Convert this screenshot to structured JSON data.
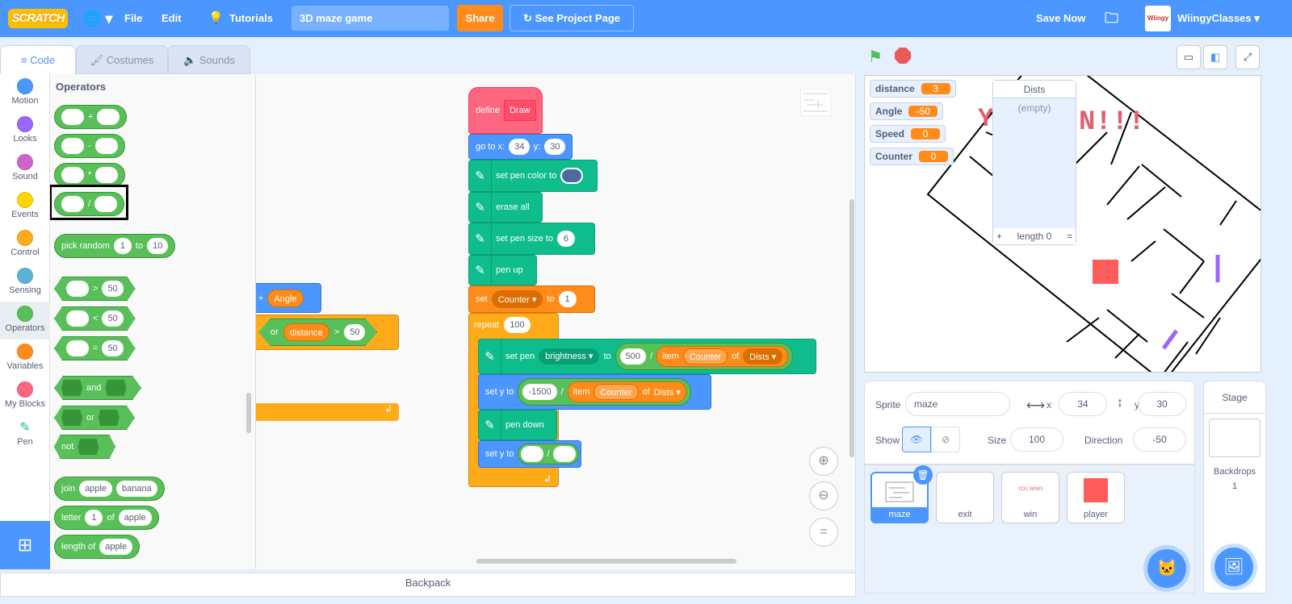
{
  "menubar": {
    "logo": "SCRATCH",
    "file": "File",
    "edit": "Edit",
    "tutorials": "Tutorials",
    "project_title": "3D maze game",
    "share": "Share",
    "see_project": "See Project Page",
    "save_now": "Save Now",
    "username": "WiingyClasses",
    "avatar_text": "Wiingy"
  },
  "tabs": [
    {
      "label": "Code"
    },
    {
      "label": "Costumes"
    },
    {
      "label": "Sounds"
    }
  ],
  "categories": [
    {
      "label": "Motion",
      "color": "#4c97ff"
    },
    {
      "label": "Looks",
      "color": "#9966ff"
    },
    {
      "label": "Sound",
      "color": "#cf63cf"
    },
    {
      "label": "Events",
      "color": "#ffd500"
    },
    {
      "label": "Control",
      "color": "#ffab19"
    },
    {
      "label": "Sensing",
      "color": "#5cb1d6"
    },
    {
      "label": "Operators",
      "color": "#59c059"
    },
    {
      "label": "Variables",
      "color": "#ff8c1a"
    },
    {
      "label": "My Blocks",
      "color": "#ff6680"
    },
    {
      "label": "Pen",
      "color": "#0fbd8c"
    }
  ],
  "palette": {
    "heading": "Operators",
    "ops": [
      "+",
      "-",
      "*",
      "/"
    ],
    "pick_random": {
      "label": "pick random",
      "a": "1",
      "to": "to",
      "b": "10"
    },
    "compare": [
      {
        "op": ">",
        "v": "50"
      },
      {
        "op": "<",
        "v": "50"
      },
      {
        "op": "=",
        "v": "50"
      }
    ],
    "and": "and",
    "or": "or",
    "not": "not",
    "join": {
      "label": "join",
      "a": "apple",
      "b": "banana"
    },
    "letter": {
      "label": "letter",
      "a": "1",
      "of": "of",
      "b": "apple"
    },
    "length": {
      "label": "length of",
      "a": "apple"
    }
  },
  "script": {
    "bg_blocks": {
      "plus": "+",
      "angle": "Angle",
      "or": "or",
      "distance": "distance",
      "gt": ">",
      "v50": "50"
    },
    "define": "define",
    "draw": "Draw",
    "goto": {
      "label": "go to x:",
      "x": "34",
      "ylabel": "y:",
      "y": "30"
    },
    "set_pen_color": "set pen color to",
    "erase_all": "erase all",
    "set_pen_size": {
      "label": "set pen size to",
      "v": "6"
    },
    "pen_up": "pen up",
    "set_var": {
      "label": "set",
      "var": "Counter",
      "to": "to",
      "v": "1"
    },
    "repeat": {
      "label": "repeat",
      "v": "100"
    },
    "set_pen_param": {
      "label": "set pen",
      "param": "brightness",
      "to": "to",
      "num": "500",
      "div": "/",
      "item": "item",
      "idx": "Counter",
      "of": "of",
      "list": "Dists"
    },
    "set_y1": {
      "label": "set y to",
      "num": "-1500",
      "div": "/",
      "item": "item",
      "idx": "Counter",
      "of": "of",
      "list": "Dists"
    },
    "pen_down": "pen down",
    "set_y2": {
      "label": "set y to",
      "div": "/"
    }
  },
  "zoom": {
    "in": "+",
    "out": "−",
    "reset": "="
  },
  "backpack": "Backpack",
  "monitors": [
    {
      "name": "distance",
      "value": "3"
    },
    {
      "name": "Angle",
      "value": "-50"
    },
    {
      "name": "Speed",
      "value": "0"
    },
    {
      "name": "Counter",
      "value": "0"
    }
  ],
  "list_monitor": {
    "title": "Dists",
    "empty": "(empty)",
    "add": "+",
    "length": "length 0",
    "resize": "="
  },
  "stage_text": "N!!!",
  "sprite_info": {
    "sprite_label": "Sprite",
    "sprite": "maze",
    "x_label": "x",
    "x": "34",
    "y_label": "y",
    "y": "30",
    "show_label": "Show",
    "size_label": "Size",
    "size": "100",
    "direction_label": "Direction",
    "direction": "-50"
  },
  "sprites": [
    {
      "name": "maze",
      "selected": true
    },
    {
      "name": "exit"
    },
    {
      "name": "win",
      "thumb_text": "YOU WIN!!!"
    },
    {
      "name": "player"
    }
  ],
  "stage_panel": {
    "title": "Stage",
    "backdrops_label": "Backdrops",
    "backdrops": "1"
  },
  "colors": {
    "menubar": "#4c97ff",
    "operators": "#59c059",
    "pen": "#0fbd8c",
    "control": "#ffab19",
    "variables": "#ff8c1a",
    "myblocks": "#ff6680"
  }
}
